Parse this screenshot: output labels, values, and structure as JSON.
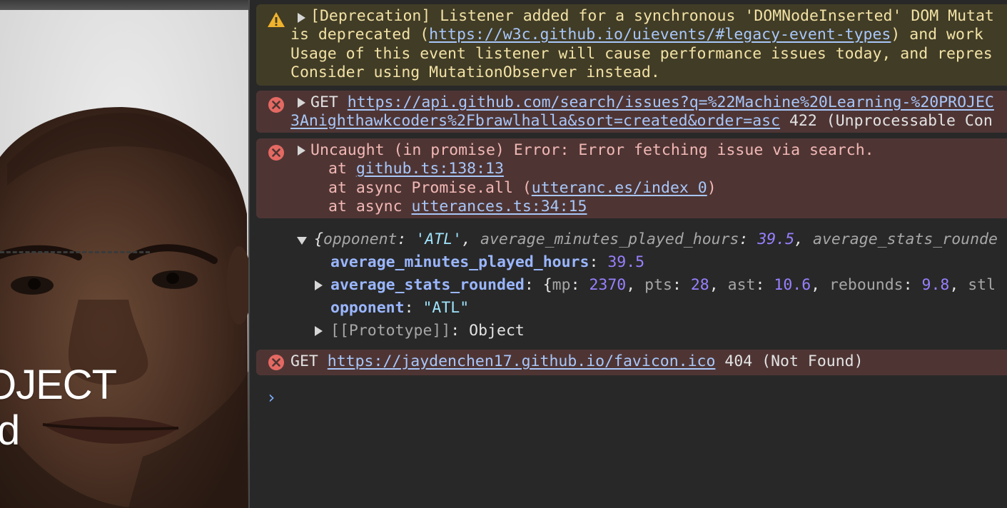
{
  "preview": {
    "overlay_line1": "OJECT",
    "overlay_line2": "d"
  },
  "console": {
    "warning": {
      "toggle": "▶",
      "line1": "[Deprecation] Listener added for a synchronous 'DOMNodeInserted' DOM Mutat",
      "line2_pre": "is deprecated (",
      "line2_link": "https://w3c.github.io/uievents/#legacy-event-types",
      "line2_post": ") and work",
      "line3": "Usage of this event listener will cause performance issues today, and repres",
      "line4": "Consider using MutationObserver instead."
    },
    "error_get_issues": {
      "method": "GET ",
      "url_line1": "https://api.github.com/search/issues?q=%22Machine%20Learning-%20PROJEC",
      "url_line2": "3Anighthawkcoders%2Fbrawlhalla&sort=created&order=asc",
      "status": " 422 (Unprocessable Con"
    },
    "error_uncaught": {
      "message": "Uncaught (in promise) Error: Error fetching issue via search.",
      "stack1_pre": "at ",
      "stack1_link": "github.ts:138:13",
      "stack2_pre": "at async Promise.all (",
      "stack2_link": "utteranc.es/index 0",
      "stack2_post": ")",
      "stack3_pre": "at async ",
      "stack3_link": "utterances.ts:34:15"
    },
    "object_log": {
      "summary": {
        "open": "{",
        "k1": "opponent",
        "v1": "'ATL'",
        "k2": "average_minutes_played_hours",
        "v2": "39.5",
        "k3": "average_stats_rounde"
      },
      "prop1": {
        "key": "average_minutes_played_hours",
        "value": "39.5"
      },
      "prop2": {
        "key": "average_stats_rounded",
        "preview_open": "{",
        "mp_key": "mp",
        "mp_val": "2370",
        "pts_key": "pts",
        "pts_val": "28",
        "ast_key": "ast",
        "ast_val": "10.6",
        "reb_key": "rebounds",
        "reb_val": "9.8",
        "stl_key": "stl"
      },
      "prop3": {
        "key": "opponent",
        "value": "\"ATL\""
      },
      "prototype": {
        "key": "[[Prototype]]",
        "value": "Object"
      }
    },
    "error_favicon": {
      "method": "GET ",
      "url": "https://jaydenchen17.github.io/favicon.ico",
      "status": " 404 (Not Found)"
    },
    "prompt": "›"
  },
  "colors": {
    "console_bg": "#282828",
    "warning_bg": "#413c26",
    "error_bg": "#4e3534",
    "link": "#a8c7fa",
    "number": "#9980ff",
    "string": "#9fe3fc",
    "key": "#9ab6ff"
  },
  "icons": [
    "warning-triangle-icon",
    "error-circle-icon",
    "disclosure-triangle-icon",
    "console-prompt-chevron-icon"
  ]
}
